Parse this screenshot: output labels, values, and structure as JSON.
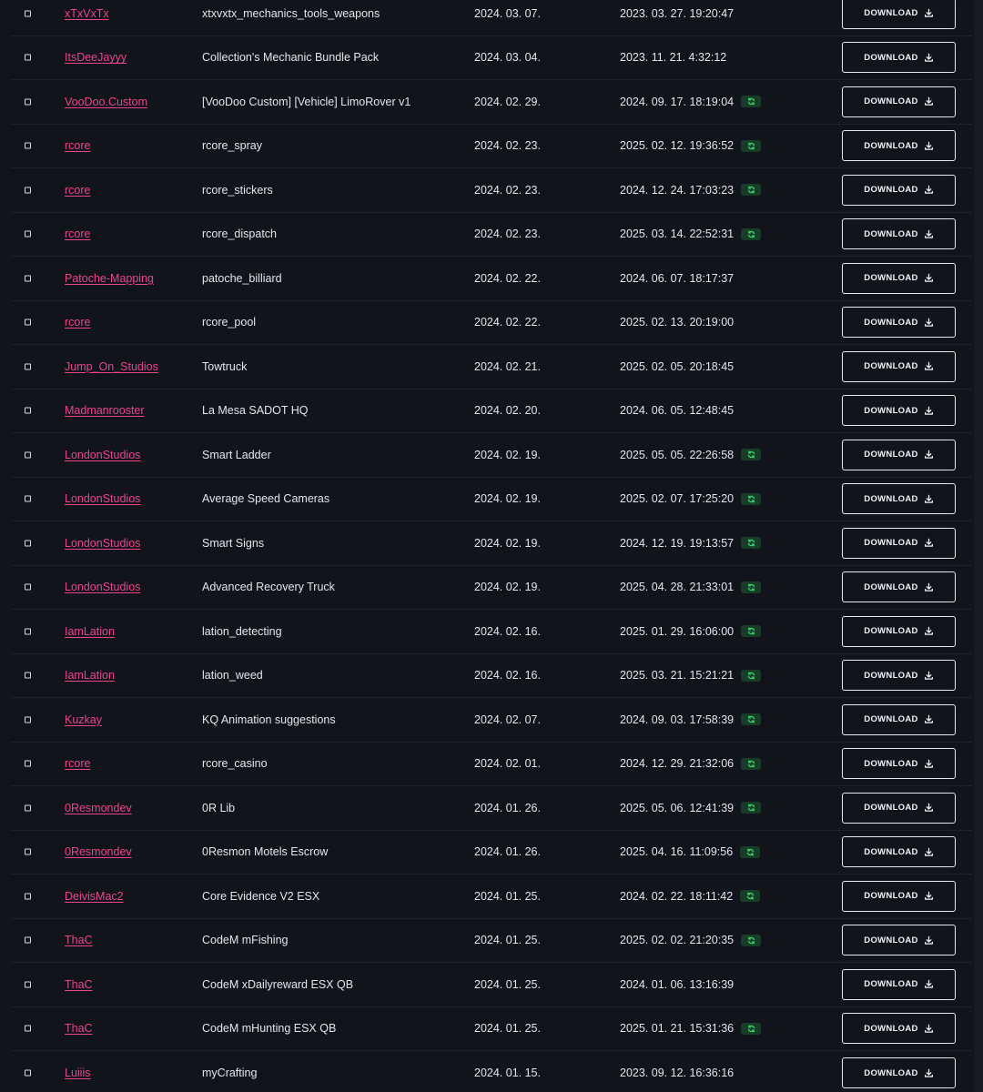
{
  "colors": {
    "background": "#12141b",
    "author_link": "#e9468e",
    "sync_badge_bg": "#173d28",
    "sync_icon": "#3ecf6a"
  },
  "download_label": "DOWNLOAD",
  "icons": {
    "download": "download-icon",
    "sync": "sync-icon",
    "checkbox": "checkbox"
  },
  "rows": [
    {
      "author": "xTxVxTx",
      "name": "xtxvxtx_mechanics_tools_weapons",
      "date": "2024. 03. 07.",
      "updated": "2023. 03. 27. 19:20:47",
      "synced": false
    },
    {
      "author": "ItsDeeJayyy",
      "name": "Collection's Mechanic Bundle Pack",
      "date": "2024. 03. 04.",
      "updated": "2023. 11. 21. 4:32:12",
      "synced": false
    },
    {
      "author": "VooDoo.Custom",
      "name": "[VooDoo Custom] [Vehicle] LimoRover v1",
      "date": "2024. 02. 29.",
      "updated": "2024. 09. 17. 18:19:04",
      "synced": true
    },
    {
      "author": "rcore",
      "name": "rcore_spray",
      "date": "2024. 02. 23.",
      "updated": "2025. 02. 12. 19:36:52",
      "synced": true
    },
    {
      "author": "rcore",
      "name": "rcore_stickers",
      "date": "2024. 02. 23.",
      "updated": "2024. 12. 24. 17:03:23",
      "synced": true
    },
    {
      "author": "rcore",
      "name": "rcore_dispatch",
      "date": "2024. 02. 23.",
      "updated": "2025. 03. 14. 22:52:31",
      "synced": true
    },
    {
      "author": "Patoche-Mapping",
      "name": "patoche_billiard",
      "date": "2024. 02. 22.",
      "updated": "2024. 06. 07. 18:17:37",
      "synced": false
    },
    {
      "author": "rcore",
      "name": "rcore_pool",
      "date": "2024. 02. 22.",
      "updated": "2025. 02. 13. 20:19:00",
      "synced": false
    },
    {
      "author": "Jump_On_Studios",
      "name": "Towtruck",
      "date": "2024. 02. 21.",
      "updated": "2025. 02. 05. 20:18:45",
      "synced": false
    },
    {
      "author": "Madmanrooster",
      "name": "La Mesa SADOT HQ",
      "date": "2024. 02. 20.",
      "updated": "2024. 06. 05. 12:48:45",
      "synced": false
    },
    {
      "author": "LondonStudios",
      "name": "Smart Ladder",
      "date": "2024. 02. 19.",
      "updated": "2025. 05. 05. 22:26:58",
      "synced": true
    },
    {
      "author": "LondonStudios",
      "name": "Average Speed Cameras",
      "date": "2024. 02. 19.",
      "updated": "2025. 02. 07. 17:25:20",
      "synced": true
    },
    {
      "author": "LondonStudios",
      "name": "Smart Signs",
      "date": "2024. 02. 19.",
      "updated": "2024. 12. 19. 19:13:57",
      "synced": true
    },
    {
      "author": "LondonStudios",
      "name": "Advanced Recovery Truck",
      "date": "2024. 02. 19.",
      "updated": "2025. 04. 28. 21:33:01",
      "synced": true
    },
    {
      "author": "IamLation",
      "name": "lation_detecting",
      "date": "2024. 02. 16.",
      "updated": "2025. 01. 29. 16:06:00",
      "synced": true
    },
    {
      "author": "IamLation",
      "name": "lation_weed",
      "date": "2024. 02. 16.",
      "updated": "2025. 03. 21. 15:21:21",
      "synced": true
    },
    {
      "author": "Kuzkay",
      "name": "KQ Animation suggestions",
      "date": "2024. 02. 07.",
      "updated": "2024. 09. 03. 17:58:39",
      "synced": true
    },
    {
      "author": "rcore",
      "name": "rcore_casino",
      "date": "2024. 02. 01.",
      "updated": "2024. 12. 29. 21:32:06",
      "synced": true
    },
    {
      "author": "0Resmondev",
      "name": "0R Lib",
      "date": "2024. 01. 26.",
      "updated": "2025. 05. 06. 12:41:39",
      "synced": true
    },
    {
      "author": "0Resmondev",
      "name": "0Resmon Motels Escrow",
      "date": "2024. 01. 26.",
      "updated": "2025. 04. 16. 11:09:56",
      "synced": true
    },
    {
      "author": "DeivisMac2",
      "name": "Core Evidence V2 ESX",
      "date": "2024. 01. 25.",
      "updated": "2024. 02. 22. 18:11:42",
      "synced": true
    },
    {
      "author": "ThaC",
      "name": "CodeM mFishing",
      "date": "2024. 01. 25.",
      "updated": "2025. 02. 02. 21:20:35",
      "synced": true
    },
    {
      "author": "ThaC",
      "name": "CodeM xDailyreward ESX QB",
      "date": "2024. 01. 25.",
      "updated": "2024. 01. 06. 13:16:39",
      "synced": false
    },
    {
      "author": "ThaC",
      "name": "CodeM mHunting ESX QB",
      "date": "2024. 01. 25.",
      "updated": "2025. 01. 21. 15:31:36",
      "synced": true
    },
    {
      "author": "Luiiis",
      "name": "myCrafting",
      "date": "2024. 01. 15.",
      "updated": "2023. 09. 12. 16:36:16",
      "synced": false
    }
  ]
}
